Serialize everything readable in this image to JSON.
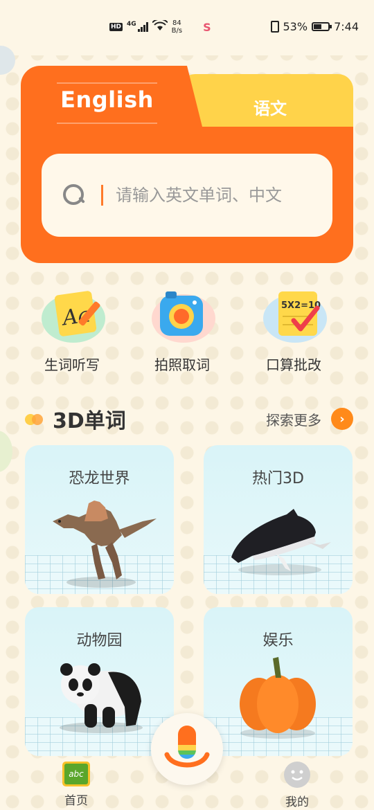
{
  "status_bar": {
    "hd": "HD",
    "network": "4G",
    "speed_value": "84",
    "speed_unit": "B/s",
    "app_icon": "S",
    "battery": "53%",
    "battery_level": 0.53,
    "time": "7:44"
  },
  "search_card": {
    "tab_active": "English",
    "tab_inactive": "语文",
    "placeholder": "请输入英文单词、中文"
  },
  "tools": [
    {
      "label": "生词听写",
      "icon": "handwriting-icon"
    },
    {
      "label": "拍照取词",
      "icon": "camera-icon"
    },
    {
      "label": "口算批改",
      "icon": "math-check-icon",
      "icon_text": "5X2=10"
    }
  ],
  "section": {
    "title": "3D单词",
    "more": "探索更多",
    "more_icon": "chevron-right-icon"
  },
  "cards": [
    {
      "label": "恐龙世界",
      "art": "dinosaur-icon"
    },
    {
      "label": "热门3D",
      "art": "whale-icon"
    },
    {
      "label": "动物园",
      "art": "panda-icon"
    },
    {
      "label": "娱乐",
      "art": "pumpkin-icon"
    }
  ],
  "bottom_nav": {
    "home": {
      "label": "首页",
      "icon_text": "abc"
    },
    "me": {
      "label": "我的"
    },
    "mic_icon": "microphone-icon"
  },
  "colors": {
    "accent_orange": "#ff6f1e",
    "tab_yellow": "#ffd34a",
    "background": "#fdf6e6"
  }
}
